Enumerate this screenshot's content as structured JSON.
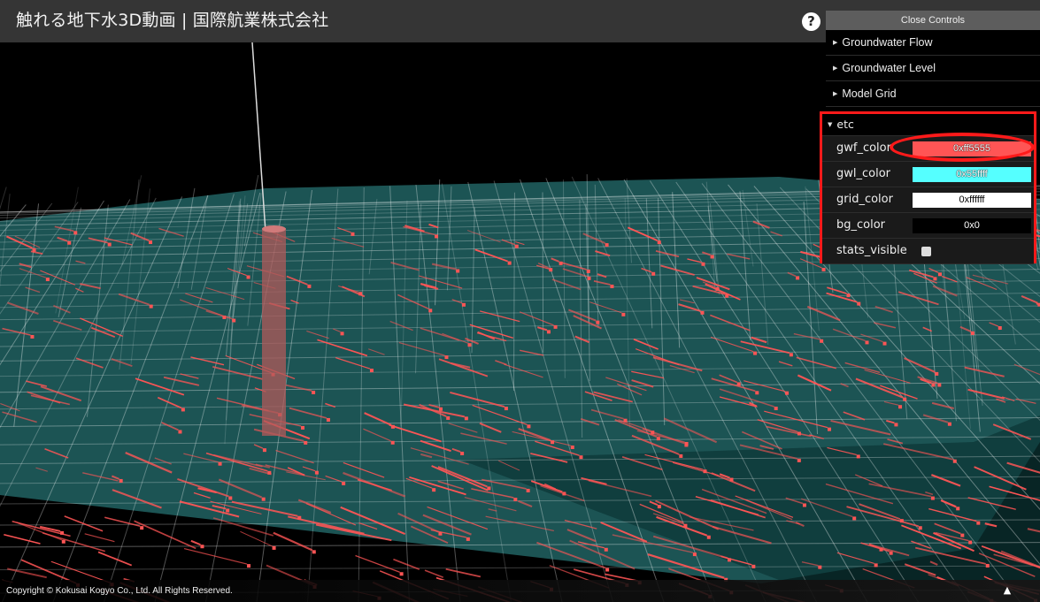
{
  "header": {
    "title": "触れる地下水3D動画 | 国際航業株式会社",
    "help_icon": "?"
  },
  "controls": {
    "close_label": "Close Controls",
    "folders": [
      {
        "label": "Groundwater Flow",
        "expanded": false
      },
      {
        "label": "Groundwater Level",
        "expanded": false
      },
      {
        "label": "Model Grid",
        "expanded": false
      }
    ],
    "etc": {
      "label": "etc",
      "expanded": true,
      "fields": [
        {
          "label": "gwf_color",
          "value": "0xff5555",
          "color": "#ff5555",
          "text_color": "#ffffff"
        },
        {
          "label": "gwl_color",
          "value": "0x55ffff",
          "color": "#55ffff",
          "text_color": "#ffffff"
        },
        {
          "label": "grid_color",
          "value": "0xffffff",
          "color": "#ffffff",
          "text_color": "#000000"
        },
        {
          "label": "bg_color",
          "value": "0x0",
          "color": "#000000",
          "text_color": "#ffffff"
        }
      ],
      "stats_visible": {
        "label": "stats_visible",
        "checked": false
      }
    }
  },
  "scene": {
    "background": "#000000",
    "flow_color": "#ff5555",
    "water_color": "#55ffff",
    "grid_color": "#ffffff",
    "well_color": "#b05a5a"
  },
  "footer": {
    "copyright": "Copyright © Kokusai Kogyo Co., Ltd. All Rights Reserved.",
    "collapse_icon": "caret-up-icon"
  },
  "annotation": {
    "highlight_color": "#ff1a1a"
  }
}
